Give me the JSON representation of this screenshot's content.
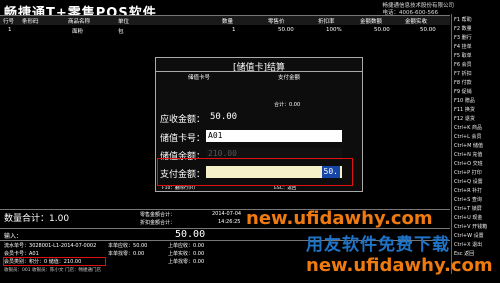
{
  "app": {
    "title": "畅捷通T+零售POS软件",
    "company": "畅捷通信息技术股份有限公司",
    "phone": "电话：4006-600-566"
  },
  "table": {
    "headers": [
      "行号",
      "条形码",
      "商品名称",
      "单位",
      "数量",
      "零售价",
      "折扣率",
      "金额数额",
      "金额实收"
    ],
    "rows": [
      {
        "no": "1",
        "name": "面粉",
        "unit": "包",
        "qty": "1",
        "price": "50.00",
        "discount": "100%",
        "amount": "50.00",
        "paid": "50.00"
      }
    ]
  },
  "sidebar": {
    "items": [
      "F1 帮助",
      "F2 数量",
      "F3 删行",
      "F4 挂单",
      "F5 取单",
      "F6 会员",
      "F7 折扣",
      "F8 付款",
      "F9 促销",
      "F10 赠品",
      "F11 换货",
      "F12 退货",
      "Ctrl+K 商品",
      "Ctrl+L 会员",
      "Ctrl+M 储值",
      "Ctrl+N 充值",
      "Ctrl+O 交班",
      "Ctrl+P 打印",
      "Ctrl+Q 设置",
      "Ctrl+R 补打",
      "Ctrl+S 查询",
      "Ctrl+T 锁屏",
      "Ctrl+U 现金",
      "Ctrl+V 开钱箱",
      "Ctrl+W 设置",
      "Ctrl+X 退出",
      "Esc 返回"
    ]
  },
  "dialog": {
    "title": "[储值卡]结算",
    "col_card": "储值卡号",
    "col_amount": "支付金额",
    "total_label": "合计：",
    "total_value": "0.00",
    "due_label": "应收金额：",
    "due_value": "50.00",
    "card_label": "储值卡号：",
    "card_value": "A01",
    "balance_label": "储值余额：",
    "balance_value": "210.00",
    "pay_label": "支付金额：",
    "pay_value": "50.",
    "f10": "F10：删除行(R)",
    "esc": "ESC：返回"
  },
  "summary": {
    "qty_label": "数量合计：",
    "qty_value": "1.00",
    "retail_total": "零售金额合计：",
    "discount_total": "折扣金额合计：",
    "date": "2014-07-04",
    "time": "14:26:25"
  },
  "input": {
    "label": "输入：",
    "amount": "50.00"
  },
  "bottom": {
    "doc_no_label": "流水单号：",
    "doc_no": "3028001-L1-2014-07-0002",
    "member_label": "会员卡号：",
    "member_no": "A01",
    "member_info": "会员类别：积分：0 储值：210.00",
    "received_label": "本单应收：",
    "received_value": "50.00",
    "change_label": "本单找零：",
    "change_value": "0.00",
    "last_received": "上单应收：",
    "last_paid": "上单实收：",
    "last_change": "上单找零：",
    "last_received_v": "0.00",
    "last_paid_v": "0.00",
    "last_change_v": "0.00",
    "status": "收银员：001  收银员：陈小文  门店：畅捷通门店"
  },
  "watermark": {
    "line1": "new.ufidawhy.com",
    "line2": "用友软件免费下载",
    "line3": "new.ufidawhy.com"
  },
  "colors": {
    "highlight_red": "#d11111",
    "selected_blue": "#1646a8",
    "watermark_orange": "#ee7a10",
    "watermark_blue": "#1f74c8"
  }
}
